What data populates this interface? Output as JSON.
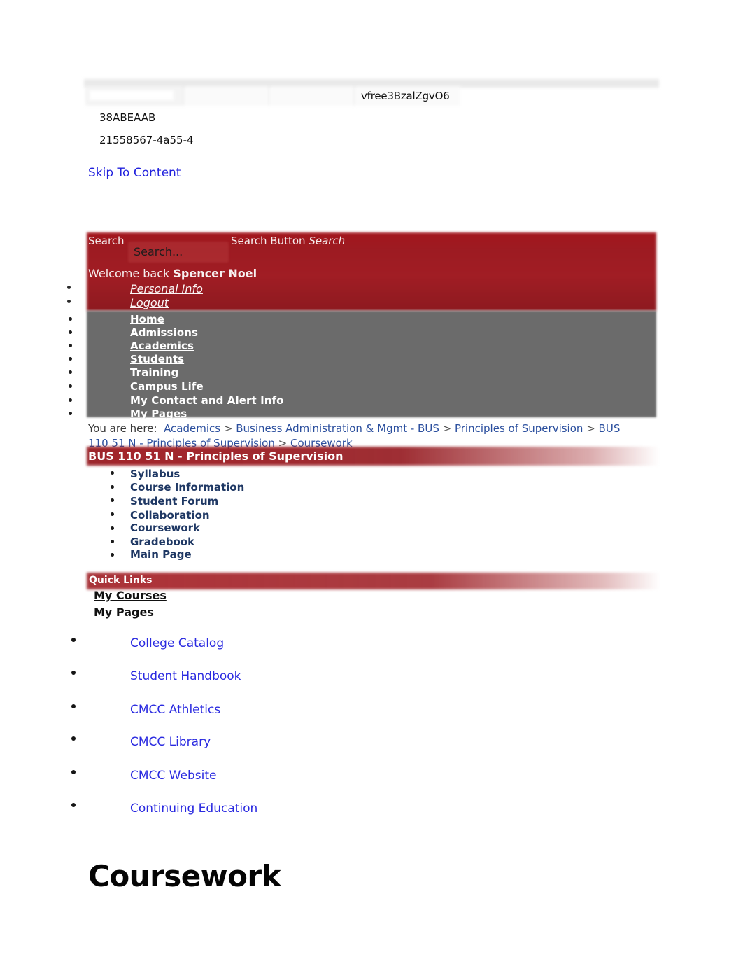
{
  "top_strip": {
    "token": "vfree3BzalZgvO6",
    "id_line_1": "38ABEAAB",
    "id_line_2": "21558567-4a55-4"
  },
  "skip_link": "Skip To Content",
  "header": {
    "search_label": "Search",
    "search_button_prefix": "Search Button ",
    "search_button_value": "Search",
    "search_placeholder": "Search...",
    "welcome_prefix": "Welcome back ",
    "user_name": "Spencer Noel",
    "account_links": [
      {
        "label": "Personal Info"
      },
      {
        "label": "Logout"
      }
    ]
  },
  "main_nav": {
    "items": [
      {
        "label": "Home"
      },
      {
        "label": "Admissions"
      },
      {
        "label": "Academics"
      },
      {
        "label": "Students"
      },
      {
        "label": "Training"
      },
      {
        "label": "Campus Life"
      },
      {
        "label": "My Contact and Alert Info"
      },
      {
        "label": "My Pages"
      }
    ]
  },
  "breadcrumb": {
    "lead": "You are here:",
    "items": [
      {
        "label": "Academics"
      },
      {
        "label": "Business Administration & Mgmt - BUS"
      },
      {
        "label": "Principles of Supervision"
      },
      {
        "label": "BUS 110 51 N - Principles of Supervision"
      },
      {
        "label": "Coursework"
      }
    ],
    "separator": ">"
  },
  "course": {
    "title": "BUS 110 51 N - Principles of Supervision",
    "nav": [
      {
        "label": "Syllabus"
      },
      {
        "label": "Course Information"
      },
      {
        "label": "Student Forum"
      },
      {
        "label": "Collaboration"
      },
      {
        "label": "Coursework"
      },
      {
        "label": "Gradebook"
      },
      {
        "label": "Main Page"
      }
    ]
  },
  "quick_links": {
    "title": "Quick Links",
    "my_courses": "My Courses",
    "my_pages": "My Pages",
    "links": [
      {
        "label": "College Catalog"
      },
      {
        "label": "Student Handbook"
      },
      {
        "label": "CMCC Athletics"
      },
      {
        "label": "CMCC Library"
      },
      {
        "label": "CMCC Website"
      },
      {
        "label": "Continuing Education"
      }
    ]
  },
  "page": {
    "heading": "Coursework"
  },
  "colors": {
    "brand_red": "#9d1b22",
    "nav_gray": "#6b6b6b",
    "link_blue": "#2a2ae0",
    "course_link_navy": "#1f3864",
    "breadcrumb_blue": "#2b4f9e"
  }
}
